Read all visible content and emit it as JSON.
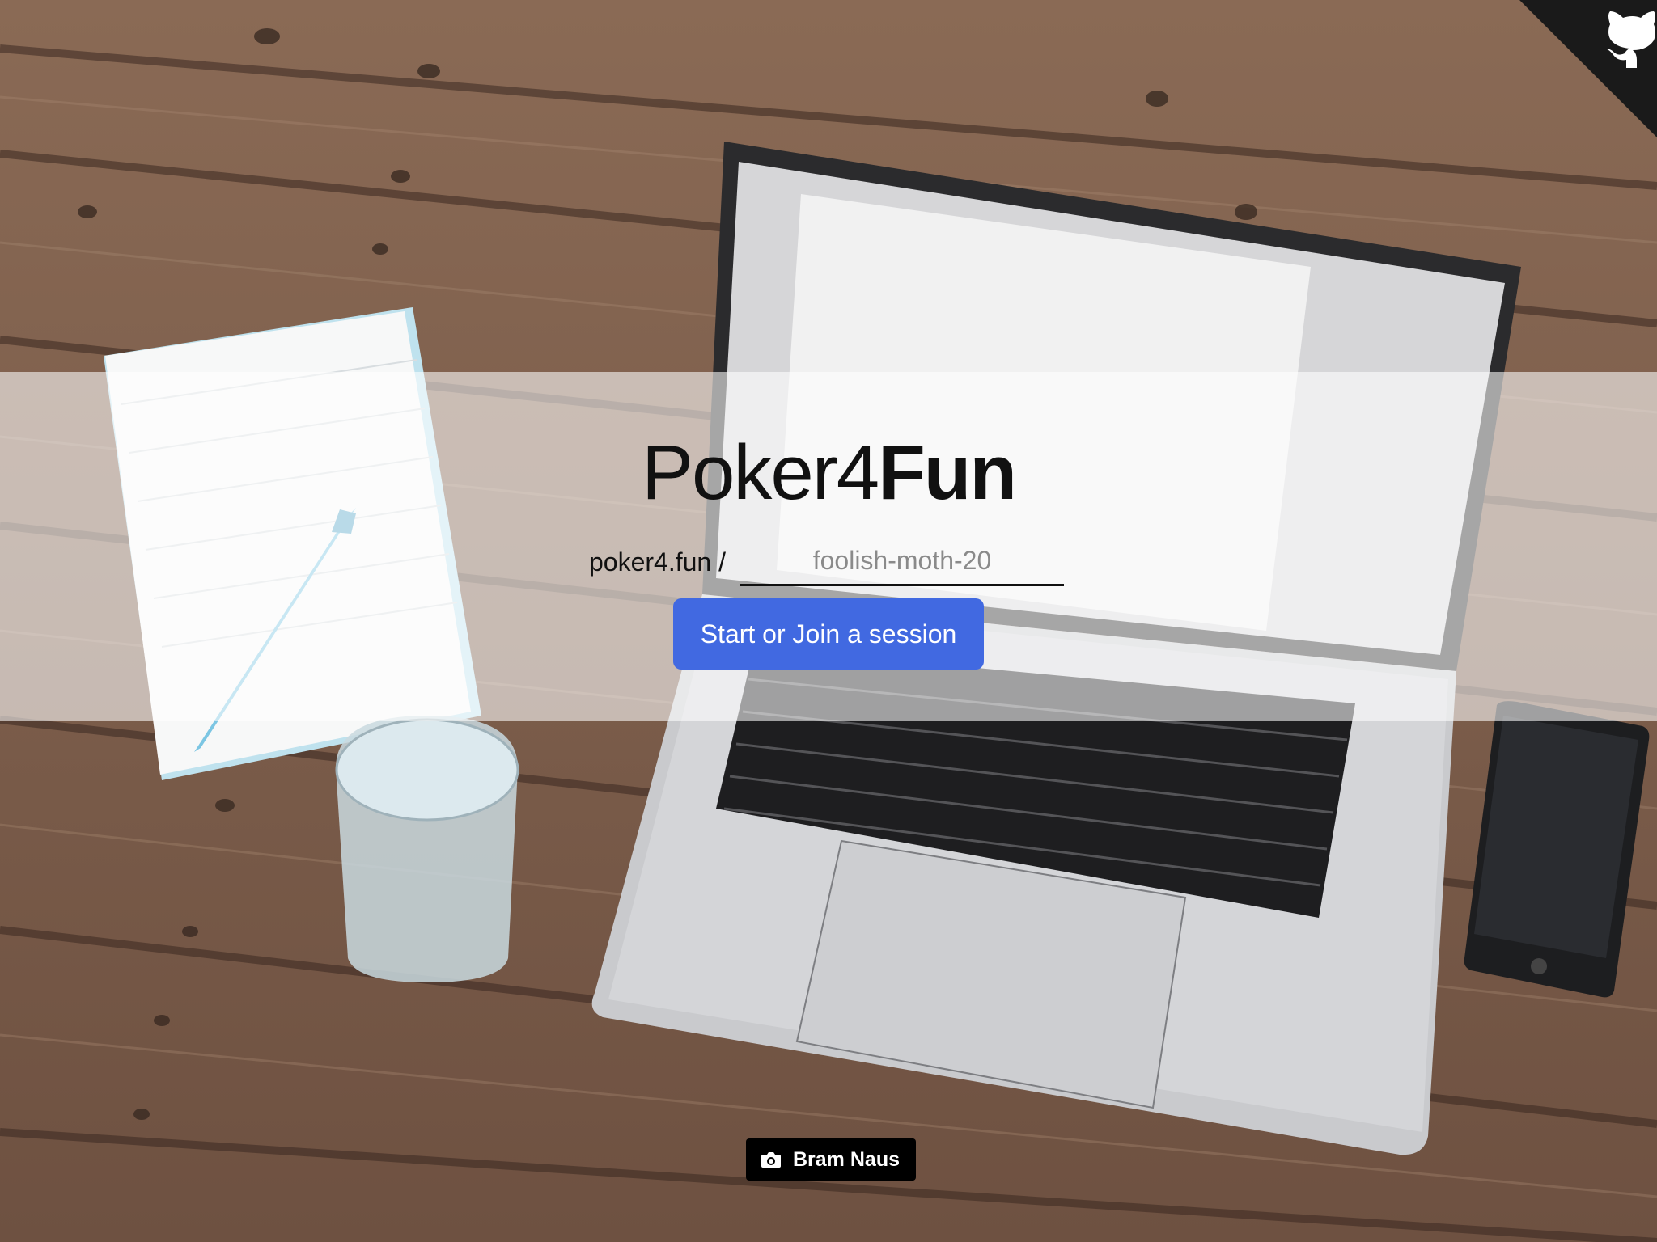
{
  "app": {
    "title_light": "Poker4",
    "title_bold": "Fun"
  },
  "session": {
    "url_prefix": "poker4.fun /",
    "placeholder": "foolish-moth-20",
    "value": ""
  },
  "actions": {
    "start_label": "Start or Join a session"
  },
  "photo_credit": {
    "name": "Bram Naus"
  },
  "colors": {
    "accent": "#4169e1",
    "band": "rgba(255,255,255,0.58)",
    "corner": "#1a1a1a"
  },
  "icons": {
    "corner": "github-octocat-icon",
    "credit": "camera-icon"
  }
}
